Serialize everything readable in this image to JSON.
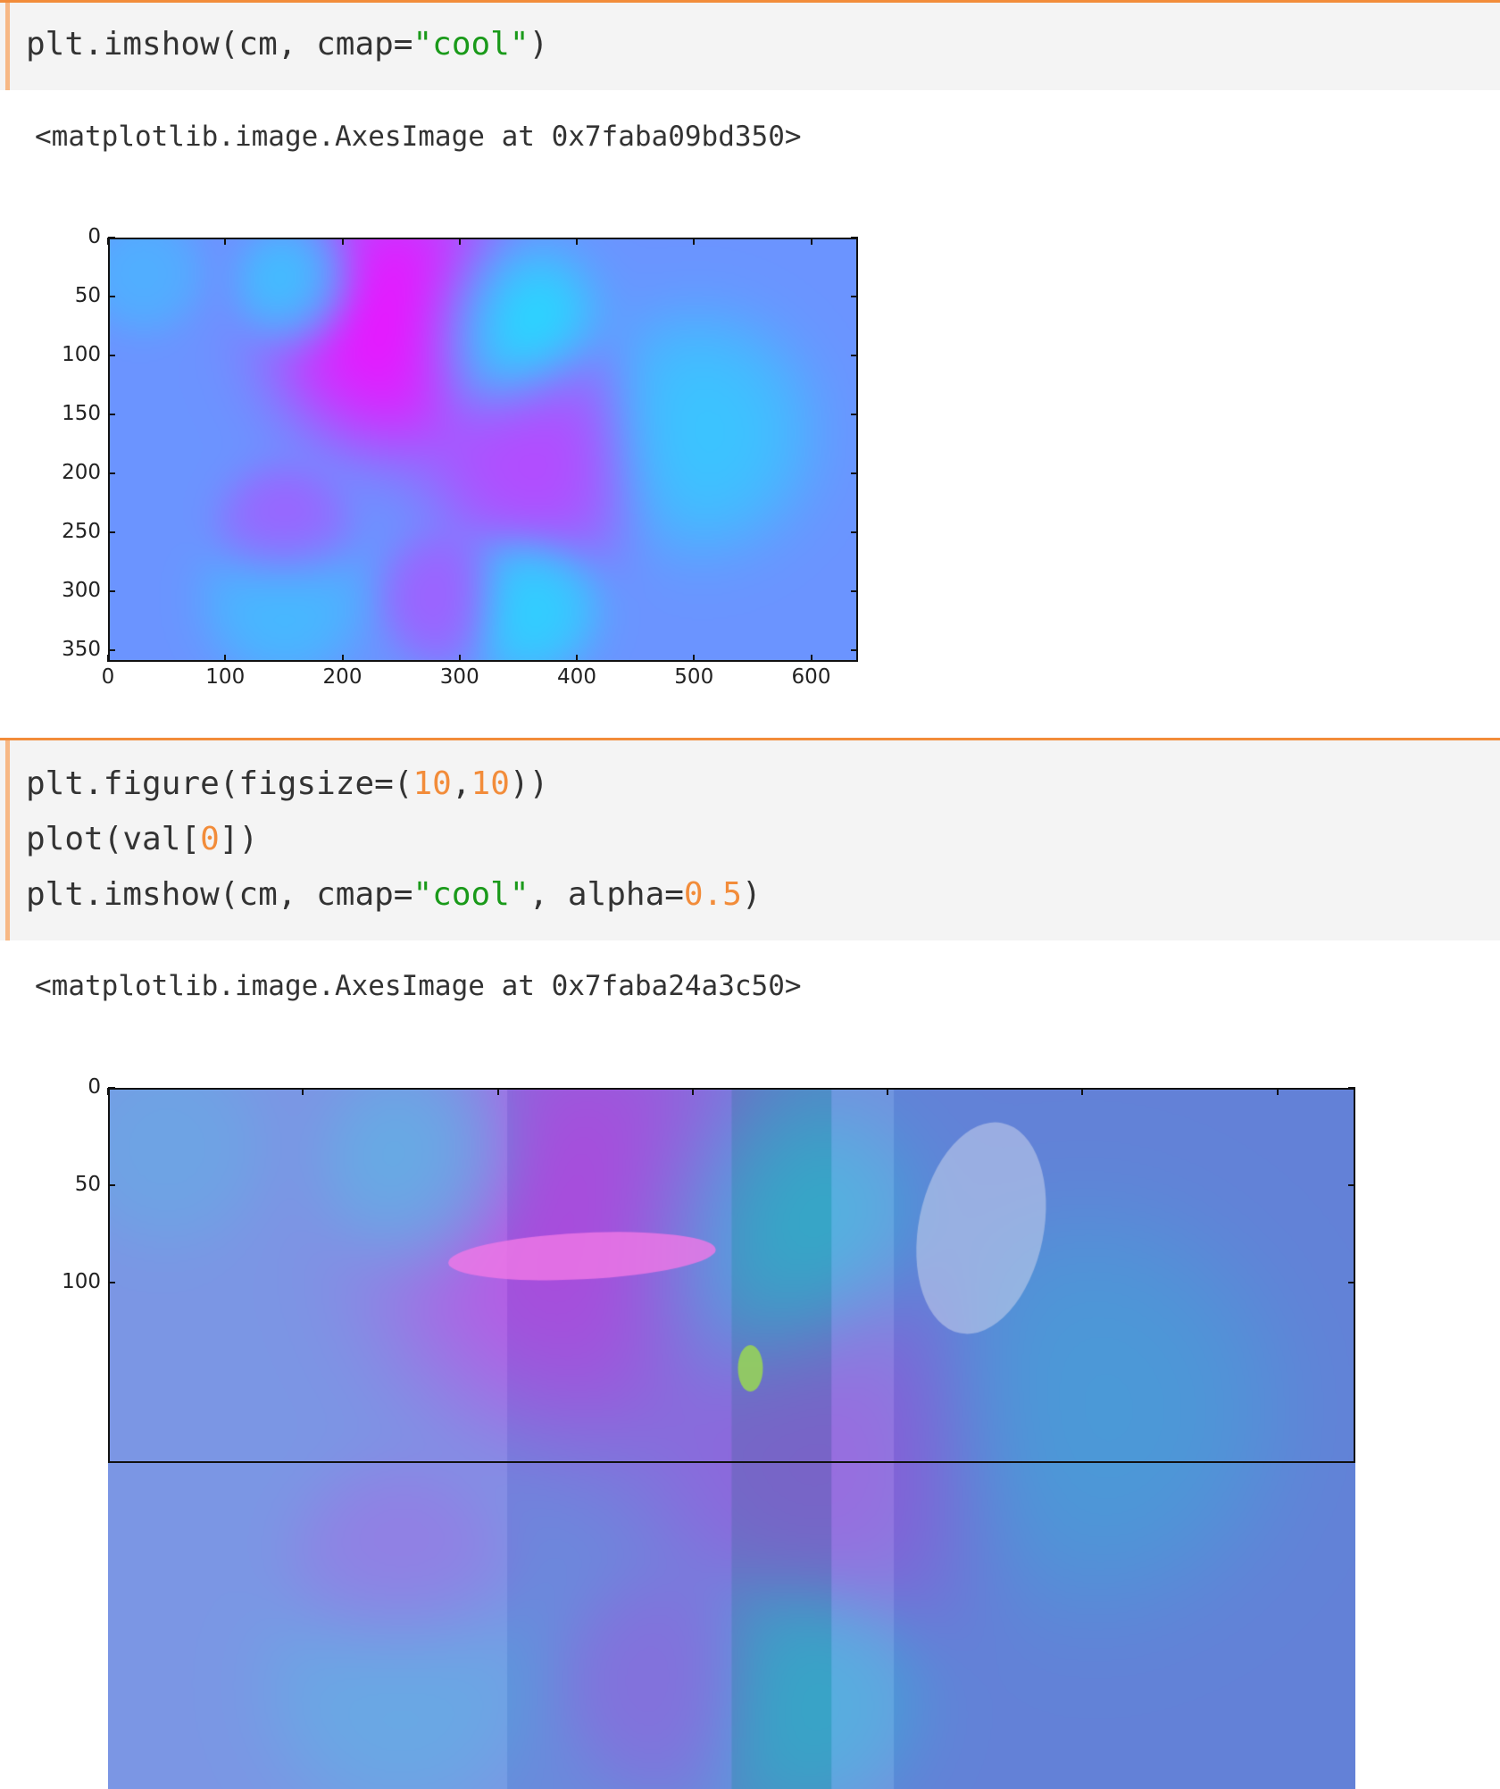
{
  "cell1": {
    "code_tokens": [
      {
        "t": "plt.imshow(cm, cmap=",
        "c": "plain"
      },
      {
        "t": "\"cool\"",
        "c": "str"
      },
      {
        "t": ")",
        "c": "plain"
      }
    ],
    "output": "<matplotlib.image.AxesImage at 0x7faba09bd350>"
  },
  "cell2": {
    "code_lines": [
      [
        {
          "t": "plt.figure(figsize=(",
          "c": "plain"
        },
        {
          "t": "10",
          "c": "num"
        },
        {
          "t": ",",
          "c": "plain"
        },
        {
          "t": "10",
          "c": "num"
        },
        {
          "t": "))",
          "c": "plain"
        }
      ],
      [
        {
          "t": "plot(val[",
          "c": "plain"
        },
        {
          "t": "0",
          "c": "num"
        },
        {
          "t": "])",
          "c": "plain"
        }
      ],
      [
        {
          "t": "plt.imshow(cm, cmap=",
          "c": "plain"
        },
        {
          "t": "\"cool\"",
          "c": "str"
        },
        {
          "t": ", alpha=",
          "c": "plain"
        },
        {
          "t": "0.5",
          "c": "num"
        },
        {
          "t": ")",
          "c": "plain"
        }
      ]
    ],
    "output": "<matplotlib.image.AxesImage at 0x7faba24a3c50>"
  },
  "colors": {
    "cell_border": "#f28c3a",
    "cell_left_bar": "#f7b885",
    "cell_bg": "#f4f4f4",
    "string": "#1a9a1a",
    "number": "#f28c3a"
  },
  "chart_data": [
    {
      "type": "heatmap",
      "colormap": "cool",
      "x_ticks": [
        "0",
        "100",
        "200",
        "300",
        "400",
        "500",
        "600"
      ],
      "y_ticks": [
        "0",
        "50",
        "100",
        "150",
        "200",
        "250",
        "300",
        "350"
      ],
      "xlim": [
        0,
        640
      ],
      "ylim": [
        360,
        0
      ],
      "blobs": [
        {
          "x": 250,
          "y": 70,
          "r": 90,
          "level": 1.0
        },
        {
          "x": 335,
          "y": 80,
          "r": 65,
          "level": 0.0
        },
        {
          "x": 165,
          "y": 40,
          "r": 45,
          "level": 0.15
        },
        {
          "x": 370,
          "y": 180,
          "r": 80,
          "level": 0.75
        },
        {
          "x": 500,
          "y": 165,
          "r": 80,
          "level": 0.2
        },
        {
          "x": 150,
          "y": 250,
          "r": 45,
          "level": 0.65
        },
        {
          "x": 290,
          "y": 305,
          "r": 45,
          "level": 0.65
        },
        {
          "x": 355,
          "y": 310,
          "r": 50,
          "level": 0.15
        },
        {
          "x": 150,
          "y": 305,
          "r": 55,
          "level": 0.25
        },
        {
          "x": 30,
          "y": 30,
          "r": 40,
          "level": 0.3
        }
      ],
      "background_level": 0.42
    },
    {
      "type": "heatmap",
      "colormap": "cool",
      "overlay_alpha": 0.5,
      "y_ticks": [
        "0",
        "50",
        "100"
      ],
      "ylim": [
        360,
        0
      ]
    }
  ]
}
